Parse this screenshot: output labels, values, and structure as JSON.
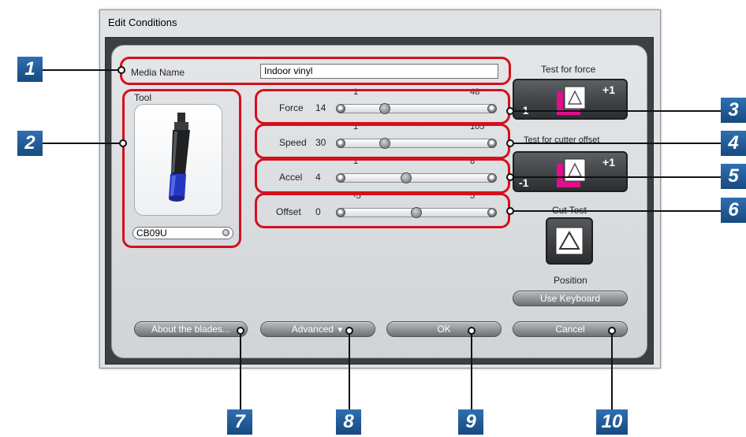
{
  "window": {
    "title": "Edit Conditions"
  },
  "media": {
    "label": "Media Name",
    "value": "Indoor vinyl"
  },
  "tool": {
    "label": "Tool",
    "selected": "CB09U"
  },
  "sliders": [
    {
      "label": "Force",
      "value": "14",
      "min": "1",
      "max": "48",
      "fraction": 0.28
    },
    {
      "label": "Speed",
      "value": "30",
      "min": "1",
      "max": "105",
      "fraction": 0.28
    },
    {
      "label": "Accel",
      "value": "4",
      "min": "1",
      "max": "8",
      "fraction": 0.43
    },
    {
      "label": "Offset",
      "value": "0",
      "min": "-5",
      "max": "5",
      "fraction": 0.5
    }
  ],
  "right_panel": {
    "test_force_label": "Test for force",
    "test_cutter_label": "Test for cutter offset",
    "plus": "+1",
    "minus": "-1",
    "cut_test_label": "Cut Test",
    "position_label": "Position",
    "use_keyboard": "Use Keyboard"
  },
  "buttons": {
    "about": "About the blades...",
    "advanced": "Advanced",
    "ok": "OK",
    "cancel": "Cancel"
  },
  "callouts": [
    "1",
    "2",
    "3",
    "4",
    "5",
    "6",
    "7",
    "8",
    "9",
    "10"
  ],
  "colors": {
    "callout_ring": "#d4101c",
    "badge": "#1f5a96",
    "accent_magenta": "#e0108c"
  },
  "icons": [
    "blade-tool-icon",
    "triangle-icon",
    "chevron-down-icon"
  ]
}
